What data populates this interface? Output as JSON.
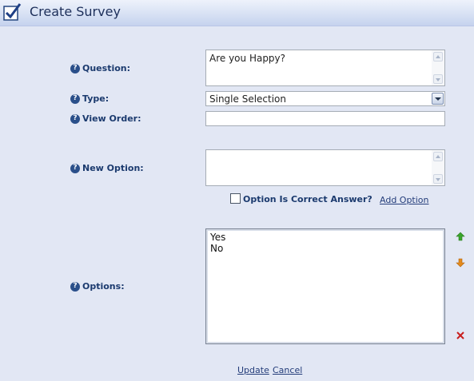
{
  "header": {
    "title": "Create Survey",
    "icon": "checkbox-checked-icon"
  },
  "form": {
    "question": {
      "label": "Question:",
      "value": "Are you Happy?"
    },
    "type": {
      "label": "Type:",
      "value": "Single Selection"
    },
    "view_order": {
      "label": "View Order:",
      "value": ""
    },
    "new_option": {
      "label": "New Option:",
      "value": ""
    },
    "is_correct": {
      "label": "Option Is Correct Answer?",
      "checked": false
    },
    "add_option": "Add Option",
    "options": {
      "label": "Options:",
      "items": [
        "Yes",
        "No"
      ]
    }
  },
  "actions": {
    "update": "Update",
    "cancel": "Cancel"
  },
  "help_icon_glyph": "?",
  "colors": {
    "label": "#1b3a6e",
    "link": "#243d7a",
    "up_arrow": "#3aa52b",
    "down_arrow": "#e48a1c",
    "delete": "#c81e1e"
  }
}
